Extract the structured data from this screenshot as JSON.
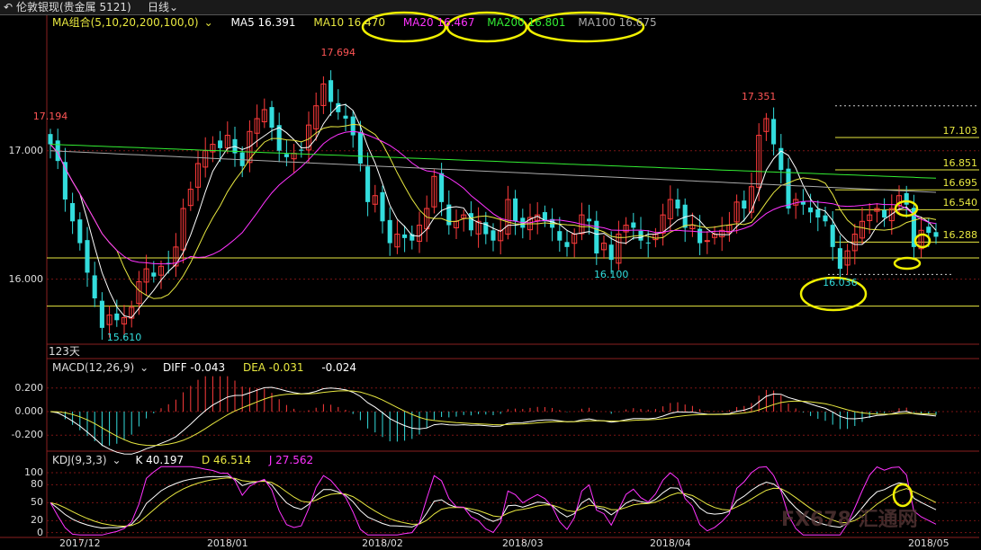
{
  "header": {
    "back_icon": "back-arrow-icon",
    "title": "伦敦银现(贵金属 5121)",
    "period": "日线",
    "period_icon": "chevron-down-icon"
  },
  "ma_legend": {
    "combo": "MA组合(5,10,20,200,100,0)",
    "combo_icon": "chevron-down-icon",
    "items": [
      {
        "label": "MA5 16.391",
        "color": "#ffffff"
      },
      {
        "label": "MA10 16.470",
        "color": "#e8e840"
      },
      {
        "label": "MA20 16.467",
        "color": "#ff33ff"
      },
      {
        "label": "MA200 16.801",
        "color": "#33ee33"
      },
      {
        "label": "MA100 16.675",
        "color": "#aaaaaa"
      }
    ]
  },
  "macd_legend": {
    "combo": "MACD(12,26,9)",
    "combo_icon": "chevron-down-icon",
    "diff": "DIFF -0.043",
    "dea": "DEA -0.031",
    "macd": "-0.024"
  },
  "kdj_legend": {
    "combo": "KDJ(9,3,3)",
    "combo_icon": "chevron-down-icon",
    "k": "K 40.197",
    "d": "D 46.514",
    "j": "J 27.562"
  },
  "days_label": "123天",
  "watermark": "FX678 汇通网",
  "chart_data": {
    "type": "candlestick",
    "price_axis": {
      "ticks": [
        17.0,
        16.0
      ],
      "labels": [
        "17.000",
        "16.000"
      ],
      "range": [
        15.5,
        17.95
      ]
    },
    "macd_axis": {
      "ticks": [
        0.2,
        0.0,
        -0.2
      ],
      "labels": [
        "0.200",
        "0.000",
        "-0.200"
      ],
      "range": [
        -0.32,
        0.32
      ]
    },
    "kdj_axis": {
      "ticks": [
        100,
        80,
        50,
        20,
        0
      ],
      "labels": [
        "100",
        "80",
        "50",
        "20",
        "0"
      ],
      "range": [
        -5,
        112
      ]
    },
    "date_labels": [
      "2017/12",
      "2018/01",
      "2018/02",
      "2018/03",
      "2018/04",
      "2018/05"
    ],
    "date_label_index": [
      4,
      24,
      45,
      64,
      84,
      119
    ],
    "annotations": [
      {
        "text": "17.194",
        "price": 17.194,
        "index": 0,
        "color": "#ff5555"
      },
      {
        "text": "17.694",
        "price": 17.694,
        "index": 39,
        "color": "#ff5555"
      },
      {
        "text": "15.610",
        "price": 15.61,
        "index": 10,
        "color": "#33dddd"
      },
      {
        "text": "16.100",
        "price": 16.1,
        "index": 76,
        "color": "#33dddd"
      },
      {
        "text": "17.351",
        "price": 17.351,
        "index": 96,
        "color": "#ff5555"
      },
      {
        "text": "16.036",
        "price": 16.036,
        "index": 107,
        "color": "#33dddd"
      }
    ],
    "level_labels": [
      {
        "text": "17.103",
        "price": 17.103
      },
      {
        "text": "16.851",
        "price": 16.851
      },
      {
        "text": "16.695",
        "price": 16.695
      },
      {
        "text": "16.540",
        "price": 16.54
      },
      {
        "text": "16.288",
        "price": 16.288
      }
    ],
    "closes": [
      17.05,
      16.92,
      16.62,
      16.45,
      16.28,
      16.05,
      15.85,
      15.62,
      15.72,
      15.68,
      15.7,
      15.78,
      15.98,
      16.08,
      16.02,
      16.1,
      16.12,
      16.25,
      16.55,
      16.7,
      16.9,
      17.0,
      17.05,
      17.02,
      17.12,
      16.98,
      16.88,
      17.15,
      17.25,
      17.32,
      17.18,
      17.0,
      16.95,
      16.98,
      17.0,
      17.2,
      17.35,
      17.52,
      17.38,
      17.3,
      17.25,
      17.12,
      16.9,
      16.6,
      16.65,
      16.45,
      16.28,
      16.35,
      16.32,
      16.3,
      16.42,
      16.55,
      16.8,
      16.6,
      16.42,
      16.45,
      16.5,
      16.38,
      16.45,
      16.35,
      16.3,
      16.38,
      16.62,
      16.45,
      16.4,
      16.48,
      16.5,
      16.45,
      16.4,
      16.3,
      16.25,
      16.35,
      16.5,
      16.45,
      16.2,
      16.28,
      16.15,
      16.35,
      16.42,
      16.4,
      16.3,
      16.28,
      16.35,
      16.5,
      16.62,
      16.55,
      16.4,
      16.42,
      16.28,
      16.3,
      16.35,
      16.38,
      16.42,
      16.6,
      16.55,
      16.72,
      17.12,
      17.25,
      17.05,
      16.85,
      16.55,
      16.62,
      16.58,
      16.52,
      16.48,
      16.45,
      16.25,
      16.08,
      16.22,
      16.35,
      16.45,
      16.5,
      16.55,
      16.48,
      16.55,
      16.65,
      16.58,
      16.25,
      16.38,
      16.36,
      16.33
    ]
  }
}
